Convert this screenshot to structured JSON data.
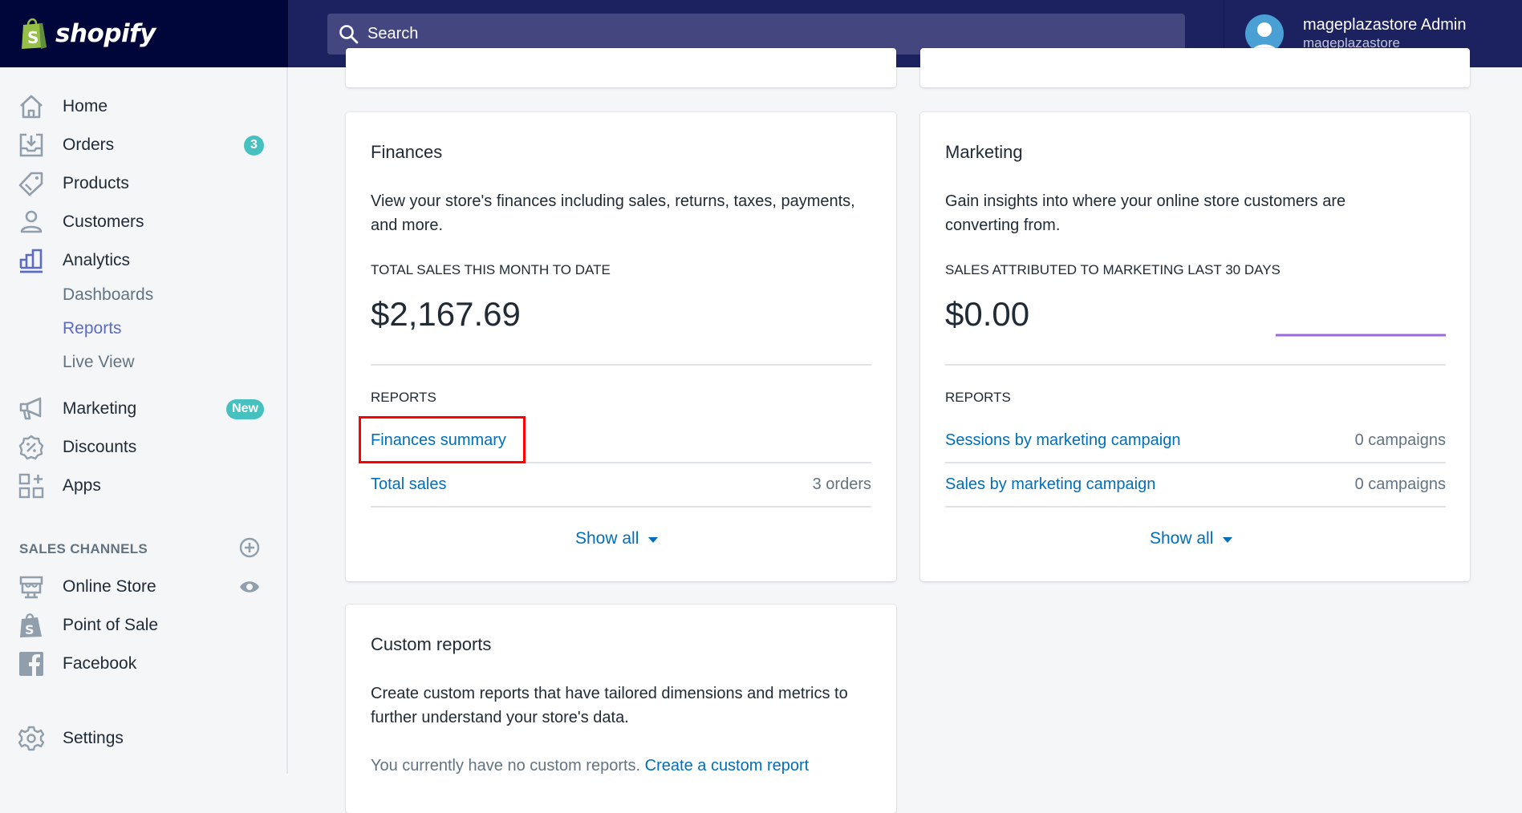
{
  "topbar": {
    "logo_text": "shopify",
    "search_placeholder": "Search",
    "user_name": "mageplazastore Admin",
    "store_name": "mageplazastore"
  },
  "sidebar": {
    "items": [
      {
        "label": "Home",
        "icon": "home-icon"
      },
      {
        "label": "Orders",
        "icon": "orders-icon",
        "badge": "3"
      },
      {
        "label": "Products",
        "icon": "tag-icon"
      },
      {
        "label": "Customers",
        "icon": "person-icon"
      },
      {
        "label": "Analytics",
        "icon": "analytics-icon"
      }
    ],
    "analytics_sub": [
      {
        "label": "Dashboards",
        "active": false
      },
      {
        "label": "Reports",
        "active": true
      },
      {
        "label": "Live View",
        "active": false
      }
    ],
    "items2": [
      {
        "label": "Marketing",
        "icon": "megaphone-icon",
        "badge": "New"
      },
      {
        "label": "Discounts",
        "icon": "discount-icon"
      },
      {
        "label": "Apps",
        "icon": "apps-icon"
      }
    ],
    "sales_channels_heading": "SALES CHANNELS",
    "channels": [
      {
        "label": "Online Store",
        "icon": "store-icon"
      },
      {
        "label": "Point of Sale",
        "icon": "pos-bag-icon"
      },
      {
        "label": "Facebook",
        "icon": "facebook-icon"
      }
    ],
    "settings_label": "Settings"
  },
  "finances": {
    "title": "Finances",
    "description": "View your store's finances including sales, returns, taxes, payments, and more.",
    "metric_label": "TOTAL SALES THIS MONTH TO DATE",
    "metric_value": "$2,167.69",
    "reports_heading": "REPORTS",
    "reports": [
      {
        "label": "Finances summary",
        "count": ""
      },
      {
        "label": "Total sales",
        "count": "3 orders"
      }
    ],
    "show_all": "Show all"
  },
  "marketing": {
    "title": "Marketing",
    "description": "Gain insights into where your online store customers are converting from.",
    "metric_label": "SALES ATTRIBUTED TO MARKETING LAST 30 DAYS",
    "metric_value": "$0.00",
    "sparkline_color": "#9c6ade",
    "reports_heading": "REPORTS",
    "reports": [
      {
        "label": "Sessions by marketing campaign",
        "count": "0 campaigns"
      },
      {
        "label": "Sales by marketing campaign",
        "count": "0 campaigns"
      }
    ],
    "show_all": "Show all"
  },
  "custom_reports": {
    "title": "Custom reports",
    "description": "Create custom reports that have tailored dimensions and metrics to further understand your store's data.",
    "empty_text": "You currently have no custom reports. ",
    "create_link": "Create a custom report"
  },
  "colors": {
    "topbar": "#1c2260",
    "logo_bg": "#000639",
    "accent": "#5c6ac4",
    "link": "#006fbb",
    "badge": "#47c1bf",
    "highlight": "#ff0000"
  }
}
